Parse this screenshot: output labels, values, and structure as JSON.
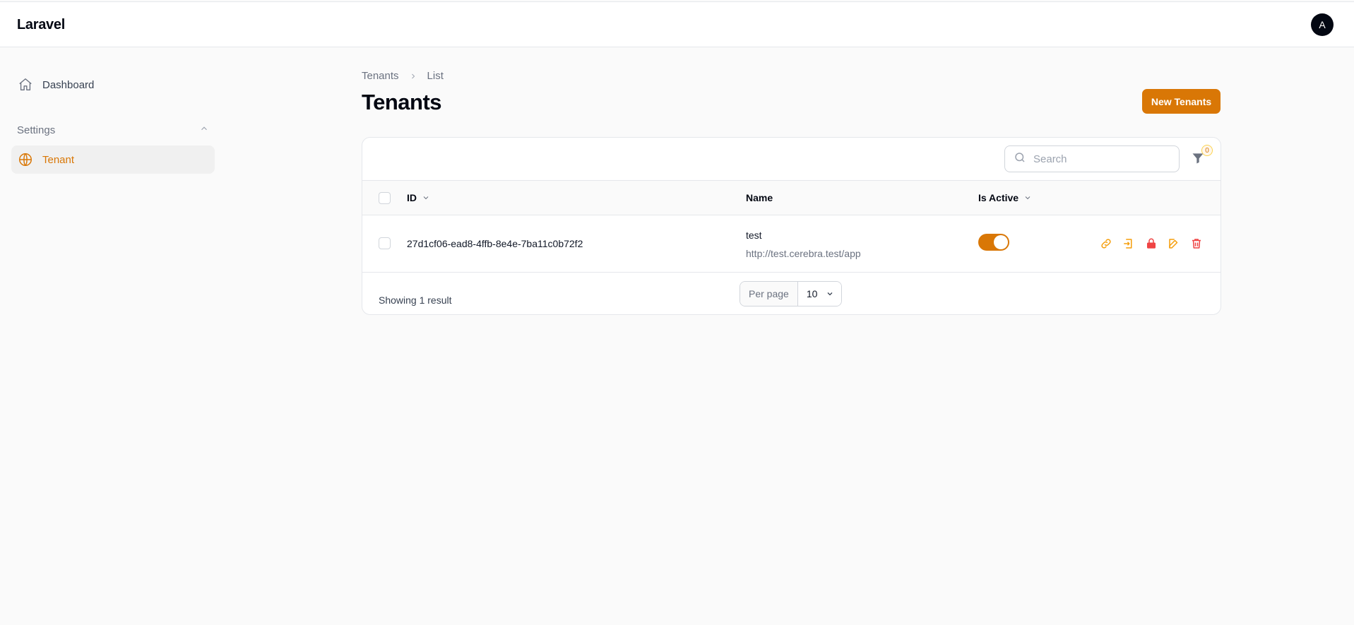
{
  "app": {
    "brand": "Laravel",
    "avatar_initial": "A"
  },
  "sidebar": {
    "dashboard_label": "Dashboard",
    "group_label": "Settings",
    "items": [
      {
        "label": "Tenant",
        "active": true
      }
    ]
  },
  "breadcrumb": {
    "parent": "Tenants",
    "current": "List"
  },
  "page": {
    "title": "Tenants",
    "new_button": "New Tenants"
  },
  "table": {
    "search_placeholder": "Search",
    "filter_count": "0",
    "columns": {
      "id": "ID",
      "name": "Name",
      "is_active": "Is Active"
    },
    "rows": [
      {
        "id": "27d1cf06-ead8-4ffb-8e4e-7ba11c0b72f2",
        "name": "test",
        "url": "http://test.cerebra.test/app",
        "is_active": true
      }
    ],
    "footer": {
      "showing": "Showing 1 result",
      "per_page_label": "Per page",
      "per_page_value": "10"
    }
  },
  "colors": {
    "accent": "#d97706",
    "danger": "#ef4444",
    "warning": "#f59e0b"
  }
}
